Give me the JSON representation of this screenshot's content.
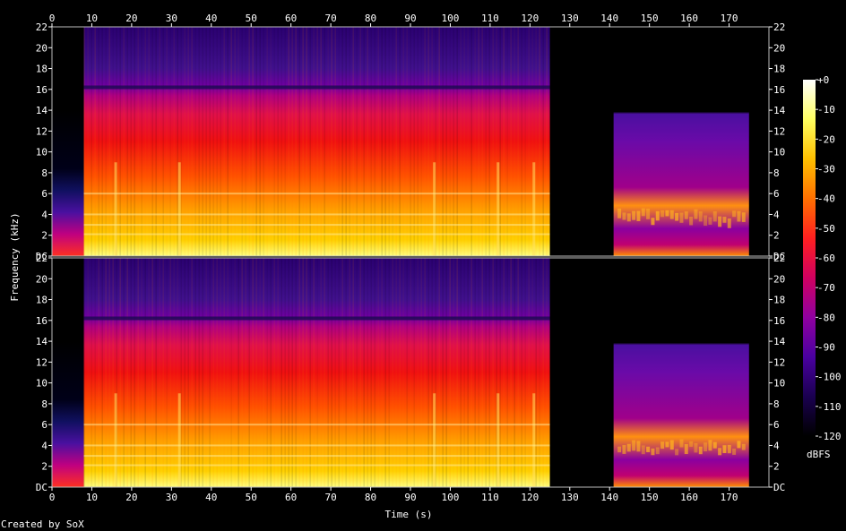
{
  "chart_data": {
    "type": "heatmap",
    "xlabel": "Time (s)",
    "ylabel": "Frequency (kHz)",
    "xlim": [
      0,
      180
    ],
    "ylim": [
      0,
      22
    ],
    "x_ticks": [
      0,
      10,
      20,
      30,
      40,
      50,
      60,
      70,
      80,
      90,
      100,
      110,
      120,
      130,
      140,
      150,
      160,
      170
    ],
    "y_ticks": [
      {
        "value": 0,
        "label": "DC"
      },
      {
        "value": 2,
        "label": "2"
      },
      {
        "value": 4,
        "label": "4"
      },
      {
        "value": 6,
        "label": "6"
      },
      {
        "value": 8,
        "label": "8"
      },
      {
        "value": 10,
        "label": "10"
      },
      {
        "value": 12,
        "label": "12"
      },
      {
        "value": 14,
        "label": "14"
      },
      {
        "value": 16,
        "label": "16"
      },
      {
        "value": 18,
        "label": "18"
      },
      {
        "value": 20,
        "label": "20"
      },
      {
        "value": 22,
        "label": "22"
      }
    ],
    "channels": [
      "top",
      "bottom"
    ],
    "segments": [
      {
        "start": 0,
        "end": 8,
        "kind": "quiet-low"
      },
      {
        "start": 8,
        "end": 125,
        "kind": "music"
      },
      {
        "start": 125,
        "end": 141,
        "kind": "silence"
      },
      {
        "start": 141,
        "end": 175,
        "kind": "noise"
      },
      {
        "start": 175,
        "end": 180,
        "kind": "silence"
      }
    ],
    "colorbar": {
      "label": "dBFS",
      "range": [
        -120,
        0
      ],
      "ticks": [
        {
          "value": 0,
          "label": "+0"
        },
        {
          "value": -10,
          "label": "-10"
        },
        {
          "value": -20,
          "label": "-20"
        },
        {
          "value": -30,
          "label": "-30"
        },
        {
          "value": -40,
          "label": "-40"
        },
        {
          "value": -50,
          "label": "-50"
        },
        {
          "value": -60,
          "label": "-60"
        },
        {
          "value": -70,
          "label": "-70"
        },
        {
          "value": -80,
          "label": "-80"
        },
        {
          "value": -90,
          "label": "-90"
        },
        {
          "value": -100,
          "label": "-100"
        },
        {
          "value": -110,
          "label": "-110"
        },
        {
          "value": -120,
          "label": "-120"
        }
      ],
      "colors": [
        "#000000",
        "#1a0050",
        "#4a00a0",
        "#9000a0",
        "#d00060",
        "#ff2020",
        "#ff7000",
        "#ffc000",
        "#ffff60",
        "#ffffff"
      ]
    }
  },
  "footer": {
    "credit": "Created by SoX"
  }
}
